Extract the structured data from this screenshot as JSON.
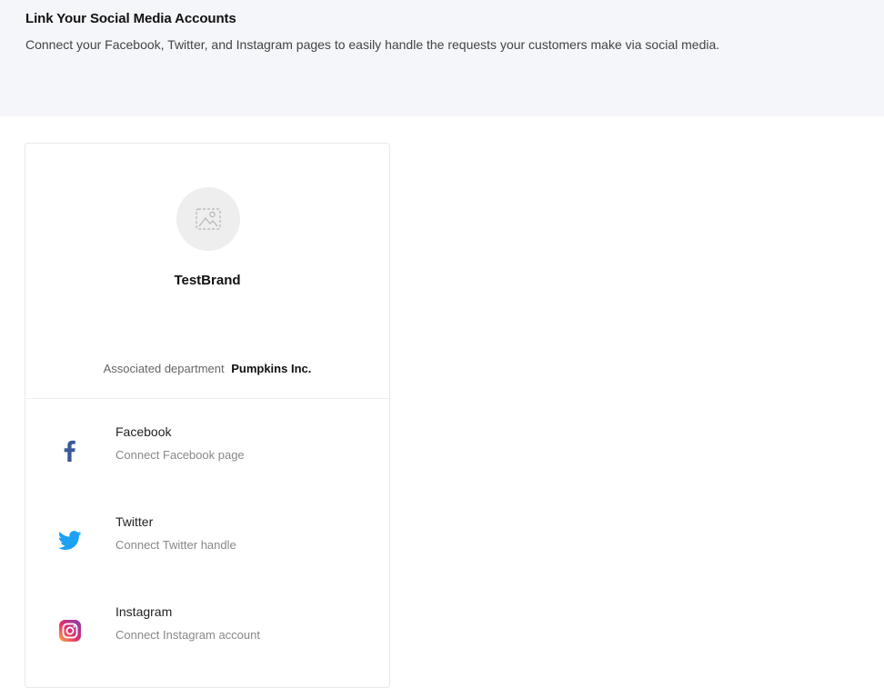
{
  "header": {
    "title": "Link Your Social Media Accounts",
    "description": "Connect your Facebook, Twitter, and Instagram pages to easily handle the requests your customers make via social media."
  },
  "brand": {
    "name": "TestBrand",
    "avatar_icon": "image-placeholder-icon",
    "department_label": "Associated department",
    "department_value": "Pumpkins Inc."
  },
  "social": [
    {
      "name": "Facebook",
      "action": "Connect Facebook page",
      "icon": "facebook-icon",
      "color": "#3b5998"
    },
    {
      "name": "Twitter",
      "action": "Connect Twitter handle",
      "icon": "twitter-icon",
      "color": "#1da1f2"
    },
    {
      "name": "Instagram",
      "action": "Connect Instagram account",
      "icon": "instagram-icon",
      "color": "#e1306c"
    }
  ]
}
